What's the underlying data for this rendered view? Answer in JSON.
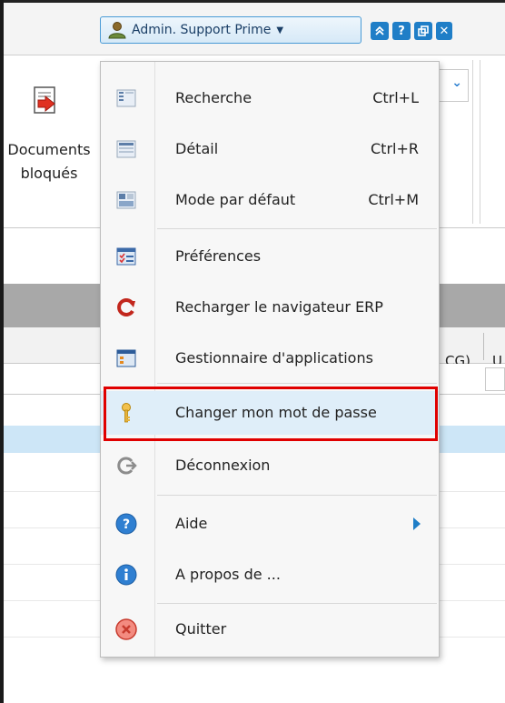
{
  "header": {
    "user_label": "Admin. Support Prime",
    "icons": [
      "collapse-up-icon",
      "help-icon",
      "restore-window-icon",
      "close-window-icon"
    ],
    "help_glyph": "?",
    "collapse_glyph": "⌃",
    "close_glyph": "✕"
  },
  "ribbon": {
    "documents_line1": "Documents",
    "documents_line2": "bloqués"
  },
  "table": {
    "visible_header_fragment": "CG)",
    "visible_header_fragment2": "U"
  },
  "menu": {
    "items": [
      {
        "label": "Recherche",
        "shortcut": "Ctrl+L",
        "icon": "search-view-icon"
      },
      {
        "label": "Détail",
        "shortcut": "Ctrl+R",
        "icon": "detail-view-icon"
      },
      {
        "label": "Mode par défaut",
        "shortcut": "Ctrl+M",
        "icon": "default-mode-icon"
      },
      {
        "label": "Préférences",
        "shortcut": "",
        "icon": "preferences-icon"
      },
      {
        "label": "Recharger le navigateur ERP",
        "shortcut": "",
        "icon": "reload-icon"
      },
      {
        "label": "Gestionnaire d'applications",
        "shortcut": "",
        "icon": "app-manager-icon"
      },
      {
        "label": "Changer mon mot de passe",
        "shortcut": "",
        "icon": "key-icon"
      },
      {
        "label": "Déconnexion",
        "shortcut": "",
        "icon": "logout-icon"
      },
      {
        "label": "Aide",
        "shortcut": "",
        "icon": "help-icon"
      },
      {
        "label": "A propos de ...",
        "shortcut": "",
        "icon": "info-icon"
      },
      {
        "label": "Quitter",
        "shortcut": "",
        "icon": "quit-icon"
      }
    ]
  },
  "colors": {
    "accent": "#1f7ec7",
    "highlight_border": "#e00000",
    "selection": "#cde6f7"
  }
}
